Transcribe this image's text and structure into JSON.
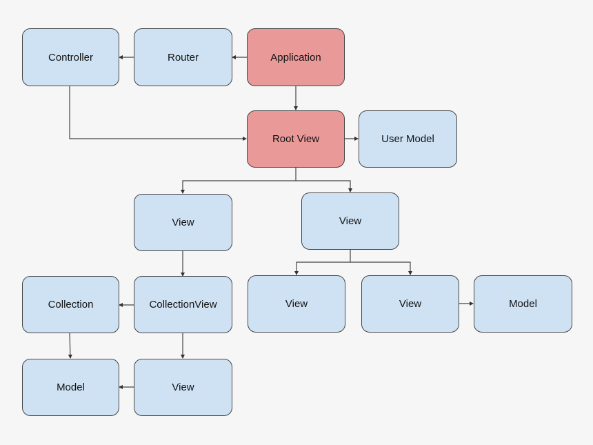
{
  "diagram": {
    "colors": {
      "default": "#cfe2f3",
      "highlight": "#ea9999",
      "background": "#f6f6f6"
    },
    "nodes": [
      {
        "id": "controller",
        "label": "Controller",
        "highlight": false
      },
      {
        "id": "router",
        "label": "Router",
        "highlight": false
      },
      {
        "id": "application",
        "label": "Application",
        "highlight": true
      },
      {
        "id": "root-view",
        "label": "Root View",
        "highlight": true
      },
      {
        "id": "user-model",
        "label": "User Model",
        "highlight": false
      },
      {
        "id": "view-left",
        "label": "View",
        "highlight": false
      },
      {
        "id": "view-right",
        "label": "View",
        "highlight": false
      },
      {
        "id": "collection",
        "label": "Collection",
        "highlight": false
      },
      {
        "id": "collection-view",
        "label": "CollectionView",
        "highlight": false
      },
      {
        "id": "view-child-a",
        "label": "View",
        "highlight": false
      },
      {
        "id": "view-child-b",
        "label": "View",
        "highlight": false
      },
      {
        "id": "model-right",
        "label": "Model",
        "highlight": false
      },
      {
        "id": "model-left",
        "label": "Model",
        "highlight": false
      },
      {
        "id": "view-bottom",
        "label": "View",
        "highlight": false
      }
    ],
    "edges": [
      {
        "from": "application",
        "to": "router"
      },
      {
        "from": "router",
        "to": "controller"
      },
      {
        "from": "application",
        "to": "root-view"
      },
      {
        "from": "controller",
        "to": "root-view"
      },
      {
        "from": "root-view",
        "to": "user-model"
      },
      {
        "from": "root-view",
        "to": "view-left"
      },
      {
        "from": "root-view",
        "to": "view-right"
      },
      {
        "from": "view-left",
        "to": "collection-view"
      },
      {
        "from": "view-right",
        "to": "view-child-a"
      },
      {
        "from": "view-right",
        "to": "view-child-b"
      },
      {
        "from": "view-child-b",
        "to": "model-right"
      },
      {
        "from": "collection-view",
        "to": "collection"
      },
      {
        "from": "collection",
        "to": "model-left"
      },
      {
        "from": "collection-view",
        "to": "view-bottom"
      },
      {
        "from": "view-bottom",
        "to": "model-left"
      }
    ]
  }
}
